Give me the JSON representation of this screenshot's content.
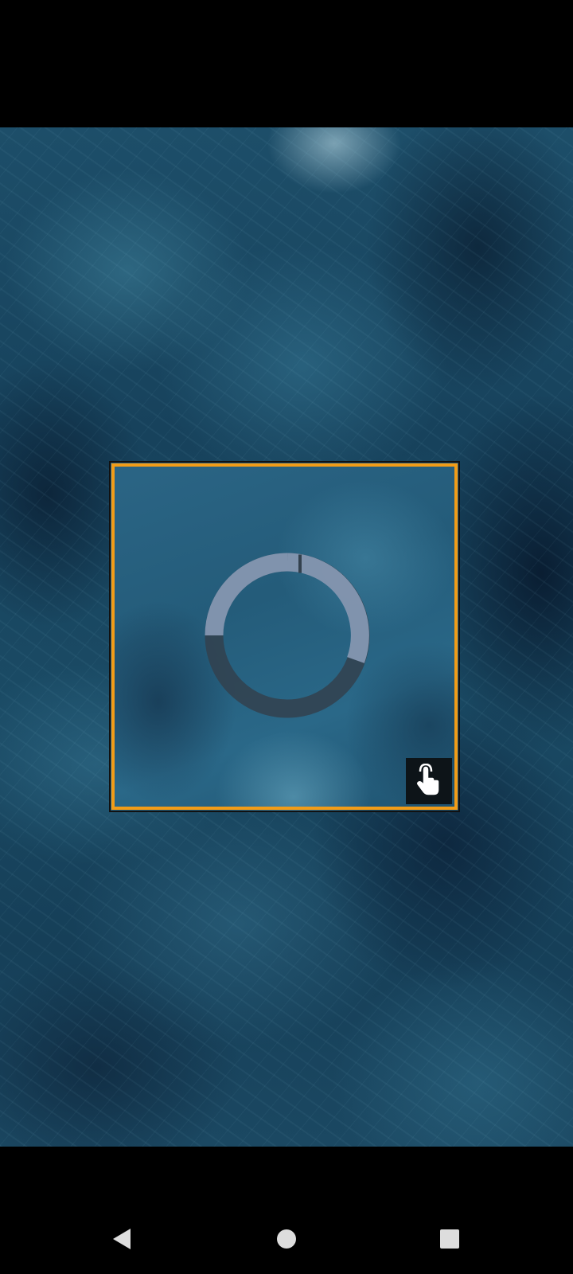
{
  "screen": {
    "background_color": "#000000"
  },
  "video": {
    "description_icon": "ocean-waves-background"
  },
  "player": {
    "border_color": "#f29c17",
    "loading_ring": {
      "track_color_light": "#8a9bb7",
      "track_color_dark": "#33414e"
    },
    "touch_icon": "tap-hand-icon"
  },
  "nav": {
    "back_icon": "back-triangle-icon",
    "home_icon": "home-circle-icon",
    "recents_icon": "recents-square-icon"
  }
}
